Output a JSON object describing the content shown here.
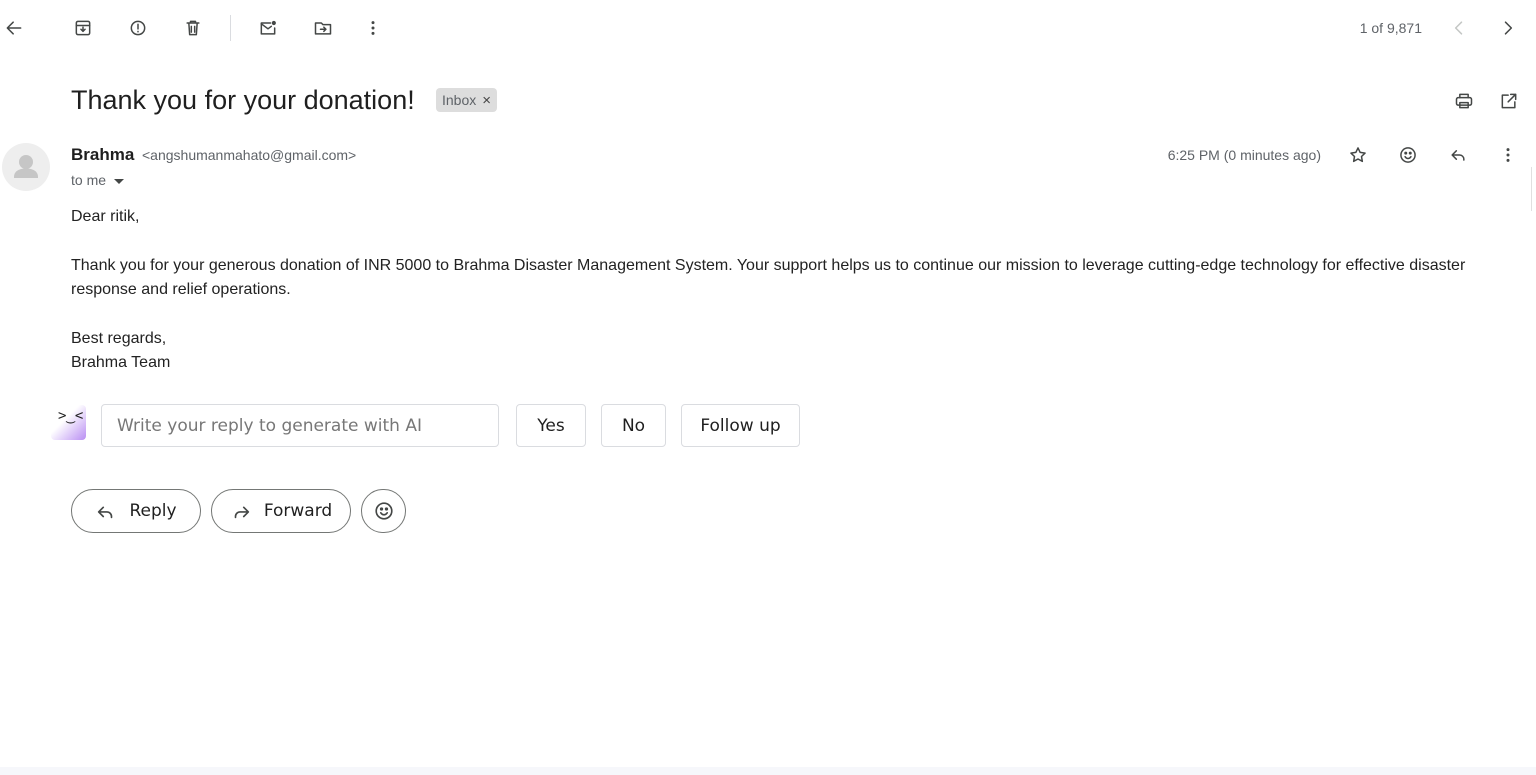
{
  "toolbar": {
    "icons": [
      "back-arrow-icon",
      "archive-icon",
      "report-spam-icon",
      "delete-icon",
      "mark-unread-icon",
      "move-to-icon",
      "more-vert-icon"
    ],
    "pagination": "1 of 9,871"
  },
  "message": {
    "subject": "Thank you for your donation!",
    "label_chip": "Inbox",
    "label_chip_close": "×",
    "sender_name": "Brahma",
    "sender_email": "<angshumanmahato@gmail.com>",
    "recipient": "to me",
    "time": "6:25 PM (0 minutes ago)",
    "body": {
      "greeting": "Dear ritik,",
      "paragraph": "Thank you for your generous donation of INR 5000 to Brahma Disaster Management System. Your support helps us to continue our mission to leverage cutting-edge technology for effective disaster response and relief operations.",
      "signoff_1": "Best regards,",
      "signoff_2": "Brahma Team"
    }
  },
  "ai_reply": {
    "logo_glyph": ">‿<",
    "placeholder": "Write your reply to generate with AI",
    "suggestions": [
      "Yes",
      "No",
      "Follow up"
    ]
  },
  "actions": {
    "reply": "Reply",
    "forward": "Forward"
  }
}
